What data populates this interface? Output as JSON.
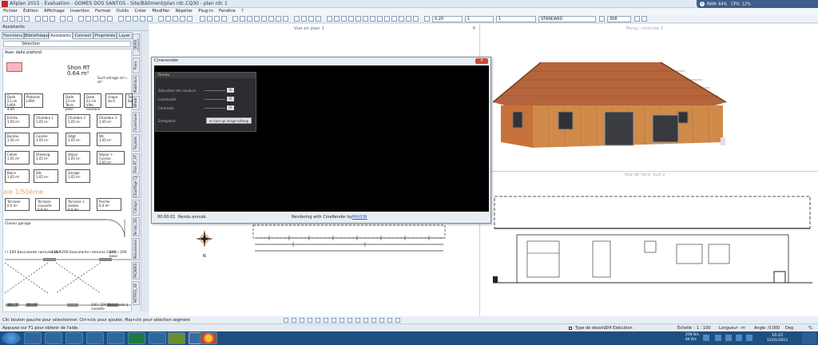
{
  "titlebar": {
    "title": "Allplan 2015 - Evaluation - GOMES DOS SANTOS - Site/Bâtiment/plan rdc.CQ30 - plan rdc 1",
    "ram": "RAM: 64%",
    "cpu": "CPU: 12%"
  },
  "menu": [
    "Fichier",
    "Édition",
    "Affichage",
    "Insertion",
    "Format",
    "Outils",
    "Créer",
    "Modifier",
    "Répéter",
    "Plug-in",
    "Fenêtre",
    "?"
  ],
  "toolbar": {
    "pen": "0.20",
    "line": "1",
    "color": "1",
    "standard": "STANDARD",
    "scale": "308"
  },
  "assistants": {
    "title": "Assistants",
    "tabs": [
      "Fonctions",
      "Bibliothèque",
      "Assistants",
      "Connect",
      "Propriétés",
      "Layer"
    ],
    "active_tab": "Assistants",
    "combo": "Sélection",
    "heading": "Avec dalle plafond",
    "shon_label": "Shon RT",
    "shon_value": "0.64 m²",
    "surf_label": "Surf vitrage m²= m²",
    "row1": [
      "Dalle 23 cm LARA 4,00",
      "Plafonds LARA",
      "Dalle 23 cm Terre plein",
      "Dalle 23 cm Vide sanitaire",
      "chape de 0",
      "Terra Balco"
    ],
    "rooms": [
      {
        "n": "Entrée",
        "a": "1.05 m²"
      },
      {
        "n": "Chambre 1",
        "a": "1.05 m²"
      },
      {
        "n": "Chambre 2",
        "a": "1.05 m²"
      },
      {
        "n": "Chambre 3",
        "a": "1.05 m²"
      },
      {
        "n": "Bureau",
        "a": "1.05 m²"
      },
      {
        "n": "Cuisine",
        "a": "1.05 m²"
      },
      {
        "n": "Dégt",
        "a": "1.05 m²"
      },
      {
        "n": "Wc",
        "a": "1.05 m²"
      },
      {
        "n": "Cellier",
        "a": "1.05 m²"
      },
      {
        "n": "Dressing",
        "a": "1.05 m²"
      },
      {
        "n": "Séjour",
        "a": "1.05 m²"
      },
      {
        "n": "Séjour + Cuisine",
        "a": "1.05 m²"
      },
      {
        "n": "Bains",
        "a": "1.05 m²"
      },
      {
        "n": "Sdc",
        "a": "1.05 m²"
      },
      {
        "n": "Garage",
        "a": "1.05 m²"
      }
    ],
    "scale_label": "ale 1/50ème",
    "terr": [
      {
        "n": "Terrasse",
        "a": "0.0 m²"
      },
      {
        "n": "Terrasse couverte",
        "a": "0.0 m²"
      },
      {
        "n": "Terrasse + lisibles",
        "a": "0.0 m²"
      },
      {
        "n": "Porche",
        "a": "0.0 m²"
      }
    ],
    "closoir": "Closoir garage",
    "door1": "l / 200 basculante ramures Vert.",
    "door2": "240 / 200 basculante ramures Horiz.",
    "door3": "240 / 200 basc",
    "door4": "240 / 200 Basculante à cassette",
    "d_a": "80 / 76",
    "d_b": "80 / 80"
  },
  "side_tabs": [
    "DEVIS ETUDES",
    "Plans",
    "Matériaux",
    "Wheat",
    "Ouvertures",
    "Façades",
    "Plan RT_HT",
    "Chauffage CJ",
    "Collage",
    "Terrain_2D",
    "Menuiseries",
    "FACADES",
    "METRES_3D"
  ],
  "views": {
    "plan": "Vue en plan 1",
    "persp": "Persp. centrale 3",
    "face": "Vue de face, sud 2"
  },
  "render": {
    "window_title": "Cinerender",
    "panel_title": "Rendu",
    "rows": [
      {
        "label": "Saturation des couleurs",
        "value": "0"
      },
      {
        "label": "Luminosité",
        "value": "0"
      },
      {
        "label": "Contraste",
        "value": "0"
      }
    ],
    "save_label": "Enregistrer",
    "save_btn": "en tant qu'image bitmap",
    "time": "00:00:01",
    "status": "Rendu annulé.",
    "credit": "Rendering with CineRender by",
    "credit_link": "MAXON"
  },
  "status": {
    "hint": "Clic bouton gauche pour sélectionner. Ctrl+clic pour ajouter, Maj+clic pour sélection segment",
    "hint2": "Appuyez sur F1 pour obtenir de l'aide.",
    "type_label": "Type de dessin :",
    "type_value": "204 Exécution",
    "echelle_label": "Échelle :",
    "echelle_value": "1 : 100",
    "longueur_label": "Longueur :",
    "longueur_value": "m",
    "angle_label": "Angle :",
    "angle_value": "0.000",
    "deg": "Deg",
    "pct": "%",
    "kb1": "208 B/s",
    "kb2": "84 B/s",
    "time": "10:22",
    "date": "12/01/2015"
  },
  "colors": {
    "accent": "#3d5e88",
    "taskbar": "#1f4f7f",
    "render_bg": "#000000",
    "wood": "#c8713a",
    "roof": "#b5643c"
  },
  "icons": [
    "app-icon",
    "start-icon",
    "ie-icon",
    "folder-icon",
    "media-icon",
    "excel-icon",
    "allplan-icon",
    "word-icon",
    "chrome-icon",
    "compass-icon"
  ]
}
